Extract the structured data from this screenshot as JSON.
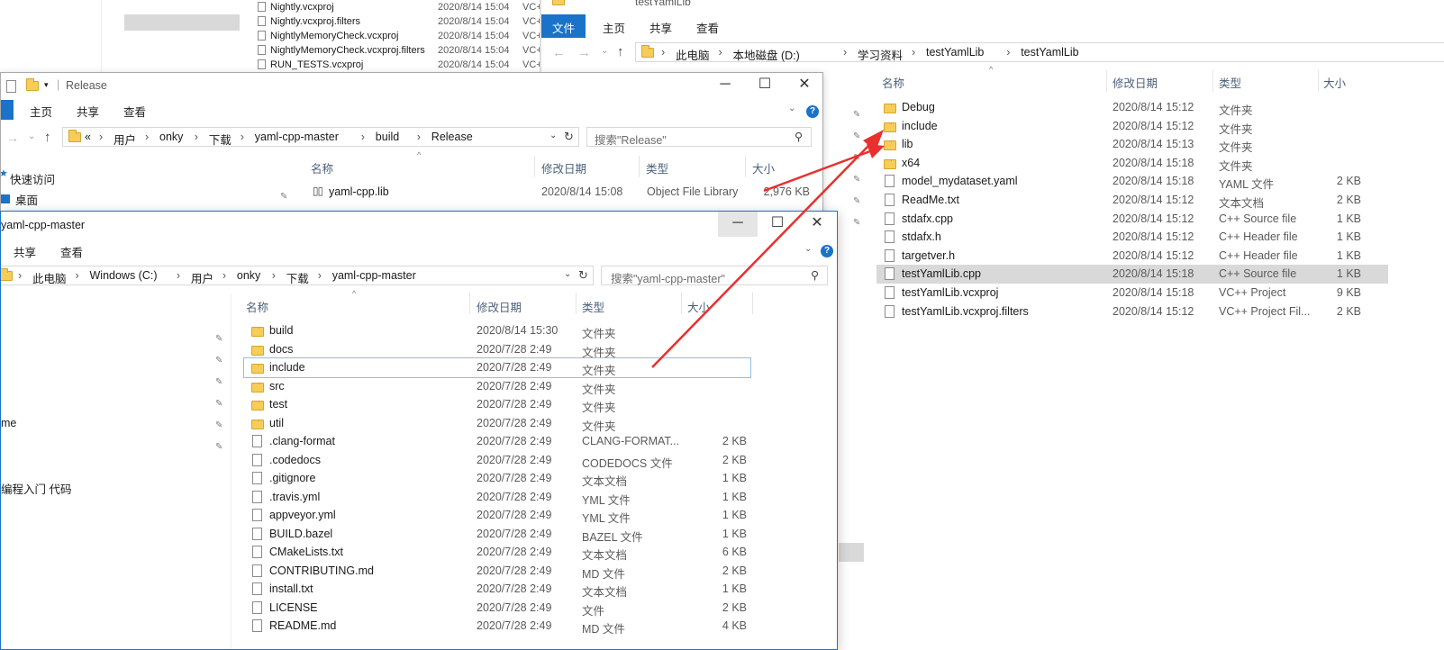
{
  "top_partial": {
    "files": [
      {
        "name": "Nightly.vcxproj",
        "date": "2020/8/14 15:04",
        "type": "VC+"
      },
      {
        "name": "Nightly.vcxproj.filters",
        "date": "2020/8/14 15:04",
        "type": "VC+"
      },
      {
        "name": "NightlyMemoryCheck.vcxproj",
        "date": "2020/8/14 15:04",
        "type": "VC+"
      },
      {
        "name": "NightlyMemoryCheck.vcxproj.filters",
        "date": "2020/8/14 15:04",
        "type": "VC+"
      },
      {
        "name": "RUN_TESTS.vcxproj",
        "date": "2020/8/14 15:04",
        "type": "VC+"
      }
    ]
  },
  "right": {
    "title": "testYamlLib",
    "tabs": [
      "文件",
      "主页",
      "共享",
      "查看"
    ],
    "breadcrumb": [
      "此电脑",
      "本地磁盘 (D:)",
      "学习资料",
      "testYamlLib",
      "testYamlLib"
    ],
    "columns": {
      "name": "名称",
      "date": "修改日期",
      "type": "类型",
      "size": "大小"
    },
    "files": [
      {
        "name": "Debug",
        "date": "2020/8/14 15:12",
        "type": "文件夹",
        "size": "",
        "icon": "folder"
      },
      {
        "name": "include",
        "date": "2020/8/14 15:12",
        "type": "文件夹",
        "size": "",
        "icon": "folder"
      },
      {
        "name": "lib",
        "date": "2020/8/14 15:13",
        "type": "文件夹",
        "size": "",
        "icon": "folder"
      },
      {
        "name": "x64",
        "date": "2020/8/14 15:18",
        "type": "文件夹",
        "size": "",
        "icon": "folder"
      },
      {
        "name": "model_mydataset.yaml",
        "date": "2020/8/14 15:18",
        "type": "YAML 文件",
        "size": "2 KB",
        "icon": "file"
      },
      {
        "name": "ReadMe.txt",
        "date": "2020/8/14 15:12",
        "type": "文本文档",
        "size": "2 KB",
        "icon": "file"
      },
      {
        "name": "stdafx.cpp",
        "date": "2020/8/14 15:12",
        "type": "C++ Source file",
        "size": "1 KB",
        "icon": "file"
      },
      {
        "name": "stdafx.h",
        "date": "2020/8/14 15:12",
        "type": "C++ Header file",
        "size": "1 KB",
        "icon": "file"
      },
      {
        "name": "targetver.h",
        "date": "2020/8/14 15:12",
        "type": "C++ Header file",
        "size": "1 KB",
        "icon": "file"
      },
      {
        "name": "testYamlLib.cpp",
        "date": "2020/8/14 15:18",
        "type": "C++ Source file",
        "size": "1 KB",
        "icon": "file"
      },
      {
        "name": "testYamlLib.vcxproj",
        "date": "2020/8/14 15:18",
        "type": "VC++ Project",
        "size": "9 KB",
        "icon": "file"
      },
      {
        "name": "testYamlLib.vcxproj.filters",
        "date": "2020/8/14 15:12",
        "type": "VC++ Project Fil...",
        "size": "2 KB",
        "icon": "file"
      }
    ]
  },
  "release": {
    "title": "Release",
    "tabs": [
      "主页",
      "共享",
      "查看"
    ],
    "breadcrumb_prefix": "«",
    "breadcrumb": [
      "用户",
      "onky",
      "下载",
      "yaml-cpp-master",
      "build",
      "Release"
    ],
    "search_placeholder": "搜索\"Release\"",
    "sidebar": {
      "quick_access": "快速访问",
      "desktop": "桌面"
    },
    "columns": {
      "name": "名称",
      "date": "修改日期",
      "type": "类型",
      "size": "大小"
    },
    "file": {
      "name": "yaml-cpp.lib",
      "date": "2020/8/14 15:08",
      "type": "Object File Library",
      "size": "2,976 KB"
    }
  },
  "yaml": {
    "title": "yaml-cpp-master",
    "tabs": [
      "共享",
      "查看"
    ],
    "breadcrumb": [
      "此电脑",
      "Windows (C:)",
      "用户",
      "onky",
      "下载",
      "yaml-cpp-master"
    ],
    "search_placeholder": "搜索\"yaml-cpp-master\"",
    "sidebar": [
      "me",
      "编程入门 代码"
    ],
    "columns": {
      "name": "名称",
      "date": "修改日期",
      "type": "类型",
      "size": "大小"
    },
    "files": [
      {
        "name": "build",
        "date": "2020/8/14 15:30",
        "type": "文件夹",
        "size": "",
        "icon": "folder"
      },
      {
        "name": "docs",
        "date": "2020/7/28 2:49",
        "type": "文件夹",
        "size": "",
        "icon": "folder"
      },
      {
        "name": "include",
        "date": "2020/7/28 2:49",
        "type": "文件夹",
        "size": "",
        "icon": "folder"
      },
      {
        "name": "src",
        "date": "2020/7/28 2:49",
        "type": "文件夹",
        "size": "",
        "icon": "folder"
      },
      {
        "name": "test",
        "date": "2020/7/28 2:49",
        "type": "文件夹",
        "size": "",
        "icon": "folder"
      },
      {
        "name": "util",
        "date": "2020/7/28 2:49",
        "type": "文件夹",
        "size": "",
        "icon": "folder"
      },
      {
        "name": ".clang-format",
        "date": "2020/7/28 2:49",
        "type": "CLANG-FORMAT...",
        "size": "2 KB",
        "icon": "file"
      },
      {
        "name": ".codedocs",
        "date": "2020/7/28 2:49",
        "type": "CODEDOCS 文件",
        "size": "2 KB",
        "icon": "file"
      },
      {
        "name": ".gitignore",
        "date": "2020/7/28 2:49",
        "type": "文本文档",
        "size": "1 KB",
        "icon": "file"
      },
      {
        "name": ".travis.yml",
        "date": "2020/7/28 2:49",
        "type": "YML 文件",
        "size": "1 KB",
        "icon": "file"
      },
      {
        "name": "appveyor.yml",
        "date": "2020/7/28 2:49",
        "type": "YML 文件",
        "size": "1 KB",
        "icon": "file"
      },
      {
        "name": "BUILD.bazel",
        "date": "2020/7/28 2:49",
        "type": "BAZEL 文件",
        "size": "1 KB",
        "icon": "file"
      },
      {
        "name": "CMakeLists.txt",
        "date": "2020/7/28 2:49",
        "type": "文本文档",
        "size": "6 KB",
        "icon": "file"
      },
      {
        "name": "CONTRIBUTING.md",
        "date": "2020/7/28 2:49",
        "type": "MD 文件",
        "size": "2 KB",
        "icon": "file"
      },
      {
        "name": "install.txt",
        "date": "2020/7/28 2:49",
        "type": "文本文档",
        "size": "1 KB",
        "icon": "file"
      },
      {
        "name": "LICENSE",
        "date": "2020/7/28 2:49",
        "type": "文件",
        "size": "2 KB",
        "icon": "file"
      },
      {
        "name": "README.md",
        "date": "2020/7/28 2:49",
        "type": "MD 文件",
        "size": "4 KB",
        "icon": "file"
      }
    ]
  },
  "colors": {
    "accent": "#1a73c8",
    "arrow": "#e8302e",
    "selected": "#d9d9d9",
    "folder": "#f5cd58"
  }
}
